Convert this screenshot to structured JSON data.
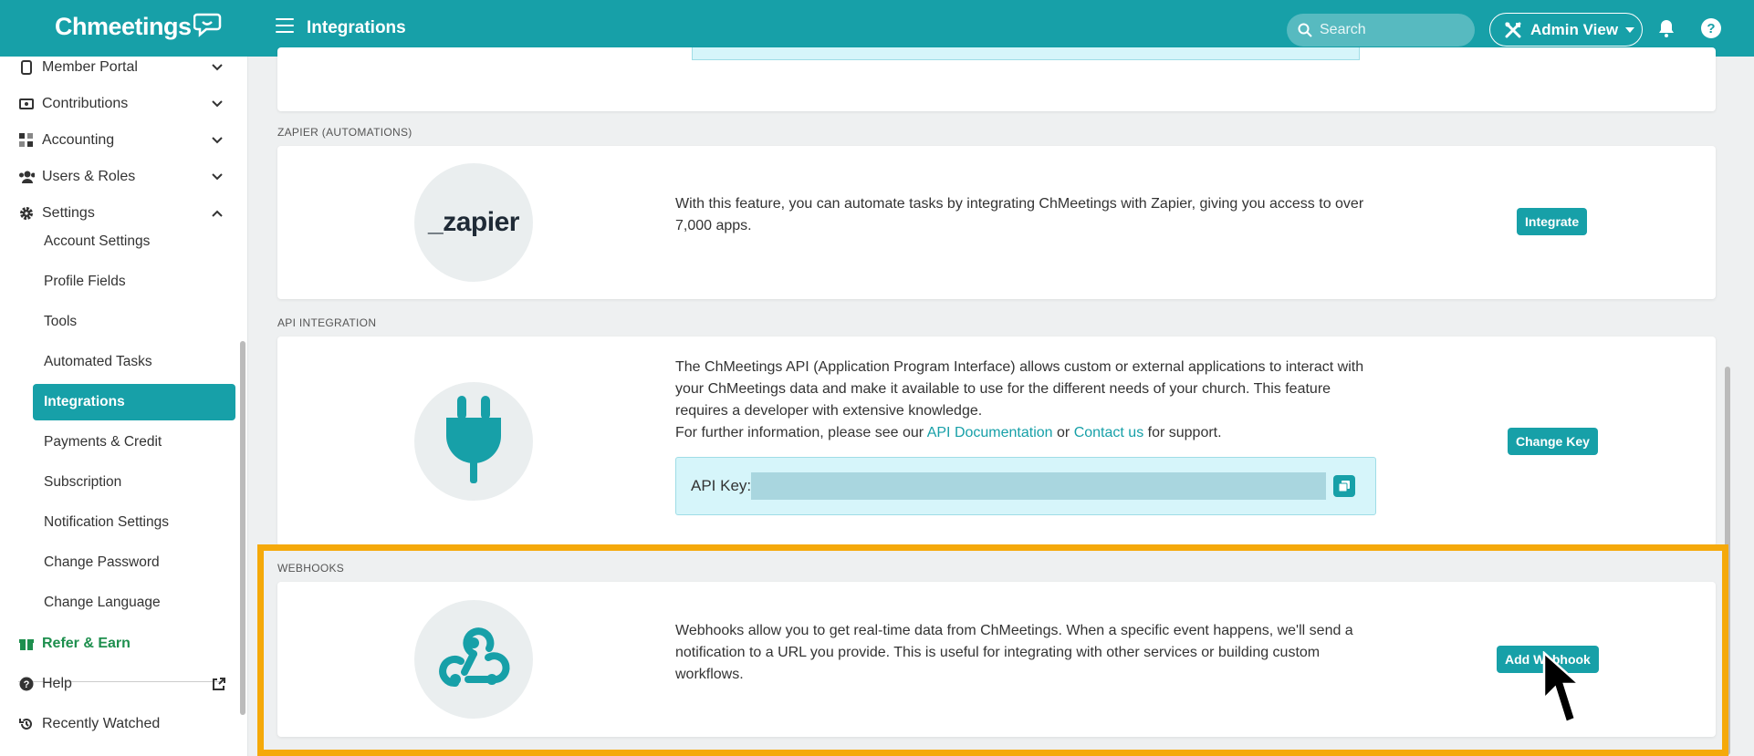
{
  "app": {
    "logo_text": "Chmeetings",
    "page_title": "Integrations"
  },
  "topbar": {
    "search_placeholder": "Search",
    "admin_view_label": "Admin View"
  },
  "sidebar": {
    "items": [
      {
        "label": "Member Portal",
        "icon": "portal-icon"
      },
      {
        "label": "Contributions",
        "icon": "money-icon"
      },
      {
        "label": "Accounting",
        "icon": "grid-icon"
      },
      {
        "label": "Users & Roles",
        "icon": "users-icon"
      },
      {
        "label": "Settings",
        "icon": "gear-icon"
      }
    ],
    "settings_subitems": [
      "Account Settings",
      "Profile Fields",
      "Tools",
      "Automated Tasks",
      "Integrations",
      "Payments & Credit",
      "Subscription",
      "Notification Settings",
      "Change Password",
      "Change Language"
    ],
    "active_subitem": "Integrations",
    "refer_label": "Refer & Earn",
    "help_label": "Help",
    "recent_label": "Recently Watched"
  },
  "sections": {
    "zapier": {
      "heading": "ZAPIER (AUTOMATIONS)",
      "logo_text": "_zapier",
      "description": "With this feature, you can automate tasks by integrating ChMeetings with Zapier, giving you access to over 7,000 apps.",
      "button": "Integrate"
    },
    "api": {
      "heading": "API INTEGRATION",
      "description": "The ChMeetings API (Application Program Interface) allows custom or external applications to interact with your ChMeetings data and make it available to use for the different needs of your church. This feature requires a developer with extensive knowledge.",
      "further_prefix": "For further information, please see our",
      "doc_link": "API Documentation",
      "or_text": "or",
      "contact_link": "Contact us",
      "further_suffix": "for support.",
      "api_key_label": "API Key:",
      "button": "Change Key"
    },
    "webhooks": {
      "heading": "WEBHOOKS",
      "description": "Webhooks allow you to get real-time data from ChMeetings. When a specific event happens, we'll send a notification to a URL you provide. This is useful for integrating with other services or building custom workflows.",
      "button": "Add Webhook"
    }
  },
  "colors": {
    "primary": "#17a0a8",
    "highlight": "#f5a90a",
    "refer": "#1e8f4e"
  }
}
